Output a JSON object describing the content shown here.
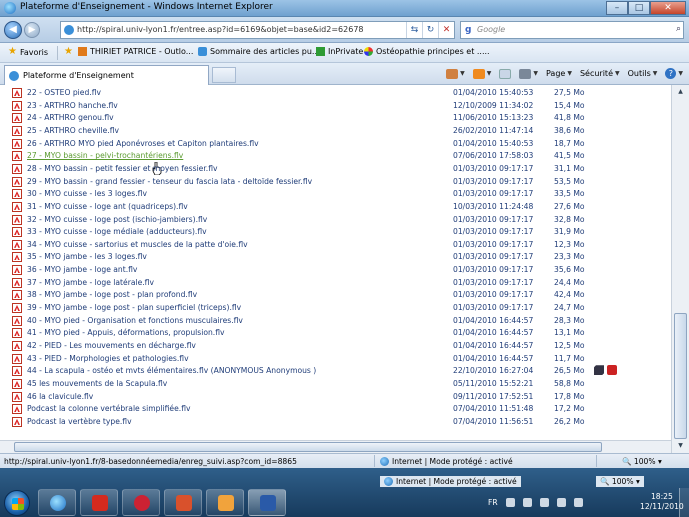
{
  "window": {
    "title": "Plateforme d'Enseignement - Windows Internet Explorer",
    "minimize": "–",
    "maximize": "□",
    "close": "✕"
  },
  "address": {
    "url": "http://spiral.univ-lyon1.fr/entree.asp?id=6169&objet=base&id2=62678",
    "search_placeholder": "Google",
    "refresh": "↻",
    "stop": "✕",
    "compat": "⇆"
  },
  "favorites": {
    "label": "Favoris",
    "items": [
      {
        "label": "THIRIET PATRICE - Outlo...",
        "icon": "outlook-icon"
      },
      {
        "label": "Sommaire des articles pu...",
        "icon": "page-icon"
      },
      {
        "label": "InPrivate",
        "icon": "inprivate-icon"
      },
      {
        "label": "Ostéopathie principes et .....",
        "icon": "multi-icon"
      }
    ]
  },
  "tab": {
    "label": "Plateforme d'Enseignement"
  },
  "commands": {
    "page": "Page",
    "security": "Sécurité",
    "tools": "Outils",
    "help": "?"
  },
  "files": [
    {
      "name": "22 - OSTEO pied.flv",
      "date": "01/04/2010 15:40:53",
      "size": "27,5 Mo"
    },
    {
      "name": "23 - ARTHRO hanche.flv",
      "date": "12/10/2009 11:34:02",
      "size": "15,4 Mo"
    },
    {
      "name": "24 - ARTHRO genou.flv",
      "date": "11/06/2010 15:13:23",
      "size": "41,8 Mo"
    },
    {
      "name": "25 - ARTHRO cheville.flv",
      "date": "26/02/2010 11:47:14",
      "size": "38,6 Mo"
    },
    {
      "name": "26 - ARTHRO MYO pied Aponévroses et Capiton plantaires.flv",
      "date": "01/04/2010 15:40:53",
      "size": "18,7 Mo"
    },
    {
      "name": "27 - MYO bassin - pelvi-trochantériens.flv",
      "date": "07/06/2010 17:58:03",
      "size": "41,5 Mo",
      "visited": true
    },
    {
      "name": "28 - MYO bassin - petit fessier et moyen fessier.flv",
      "date": "01/03/2010 09:17:17",
      "size": "31,1 Mo"
    },
    {
      "name": "29 - MYO bassin - grand fessier - tenseur du fascia lata - deltoïde fessier.flv",
      "date": "01/03/2010 09:17:17",
      "size": "53,5 Mo"
    },
    {
      "name": "30 - MYO cuisse - les 3 loges.flv",
      "date": "01/03/2010 09:17:17",
      "size": "33,5 Mo"
    },
    {
      "name": "31 - MYO cuisse - loge ant (quadriceps).flv",
      "date": "10/03/2010 11:24:48",
      "size": "27,6 Mo"
    },
    {
      "name": "32 - MYO cuisse - loge post (ischio-jambiers).flv",
      "date": "01/03/2010 09:17:17",
      "size": "32,8 Mo"
    },
    {
      "name": "33 - MYO cuisse - loge médiale (adducteurs).flv",
      "date": "01/03/2010 09:17:17",
      "size": "31,9 Mo"
    },
    {
      "name": "34 - MYO cuisse - sartorius et muscles de la patte d'oie.flv",
      "date": "01/03/2010 09:17:17",
      "size": "12,3 Mo"
    },
    {
      "name": "35 - MYO jambe - les 3 loges.flv",
      "date": "01/03/2010 09:17:17",
      "size": "23,3 Mo"
    },
    {
      "name": "36 - MYO jambe - loge ant.flv",
      "date": "01/03/2010 09:17:17",
      "size": "35,6 Mo"
    },
    {
      "name": "37 - MYO jambe - loge latérale.flv",
      "date": "01/03/2010 09:17:17",
      "size": "24,4 Mo"
    },
    {
      "name": "38 - MYO jambe - loge post - plan profond.flv",
      "date": "01/03/2010 09:17:17",
      "size": "42,4 Mo"
    },
    {
      "name": "39 - MYO jambe - loge post - plan superficiel (triceps).flv",
      "date": "01/03/2010 09:17:17",
      "size": "24,7 Mo"
    },
    {
      "name": "40 - MYO pied - Organisation et fonctions musculaires.flv",
      "date": "01/04/2010 16:44:57",
      "size": "28,3 Mo"
    },
    {
      "name": "41 - MYO pied - Appuis, déformations, propulsion.flv",
      "date": "01/04/2010 16:44:57",
      "size": "13,1 Mo"
    },
    {
      "name": "42 - PIED - Les mouvements en décharge.flv",
      "date": "01/04/2010 16:44:57",
      "size": "12,5 Mo"
    },
    {
      "name": "43 - PIED - Morphologies et pathologies.flv",
      "date": "01/04/2010 16:44:57",
      "size": "11,7 Mo"
    },
    {
      "name": "44 - La scapula - ostéo et mvts élémentaires.flv   (ANONYMOUS Anonymous )",
      "date": "22/10/2010 16:27:04",
      "size": "26,5 Mo",
      "actions": true
    },
    {
      "name": "45 les mouvements de la Scapula.flv",
      "date": "05/11/2010 15:52:21",
      "size": "58,8 Mo"
    },
    {
      "name": "46 la clavicule.flv",
      "date": "09/11/2010 17:52:51",
      "size": "17,8 Mo"
    },
    {
      "name": "Podcast la colonne vertébrale simplifiée.flv",
      "date": "07/04/2010 11:51:48",
      "size": "17,2 Mo"
    },
    {
      "name": "Podcast la vertèbre type.flv",
      "date": "07/04/2010 11:56:51",
      "size": "26,2 Mo"
    }
  ],
  "status": {
    "url": "http://spiral.univ-lyon1.fr/8-basedonnéemedia/enreg_suivi.asp?com_id=8865",
    "zone": "Internet | Mode protégé : activé",
    "zoom": "100%"
  },
  "taskbar": {
    "popup_zone": "Internet | Mode protégé : activé",
    "popup_zoom": "100%",
    "lang": "FR",
    "time": "18:25",
    "date": "12/11/2010"
  }
}
